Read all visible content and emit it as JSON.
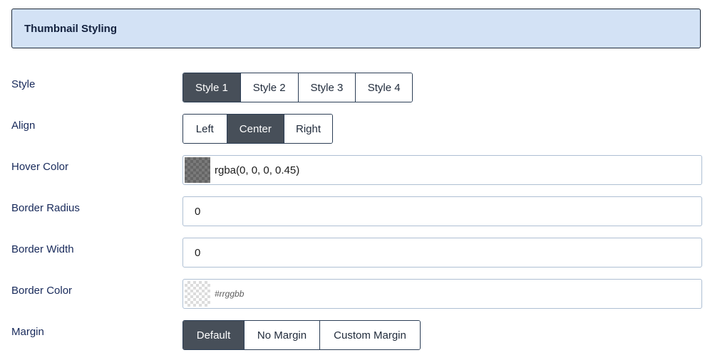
{
  "section": {
    "title": "Thumbnail Styling"
  },
  "style": {
    "label": "Style",
    "options": [
      "Style 1",
      "Style 2",
      "Style 3",
      "Style 4"
    ],
    "selected": "Style 1"
  },
  "align": {
    "label": "Align",
    "options": [
      "Left",
      "Center",
      "Right"
    ],
    "selected": "Center"
  },
  "hover_color": {
    "label": "Hover Color",
    "value": "rgba(0, 0, 0, 0.45)"
  },
  "border_radius": {
    "label": "Border Radius",
    "value": "0"
  },
  "border_width": {
    "label": "Border Width",
    "value": "0"
  },
  "border_color": {
    "label": "Border Color",
    "placeholder": "#rrggbb",
    "value": ""
  },
  "margin": {
    "label": "Margin",
    "options": [
      "Default",
      "No Margin",
      "Custom Margin"
    ],
    "selected": "Default"
  },
  "colors": {
    "header_bg": "#d3e2f5",
    "active_button": "#474f59",
    "label_text": "#17295a"
  }
}
